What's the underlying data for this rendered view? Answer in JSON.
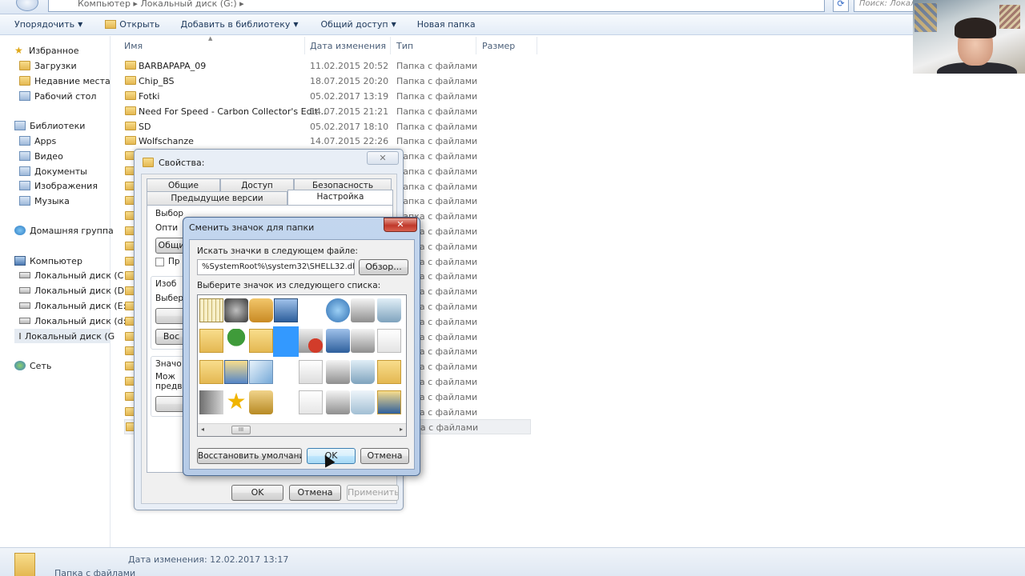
{
  "explorer": {
    "address_text": "Компьютер ▸ Локальный диск (G:) ▸",
    "search_placeholder": "Поиск: Локаль",
    "toolbar": {
      "organize": "Упорядочить",
      "open": "Открыть",
      "add_library": "Добавить в библиотеку",
      "share": "Общий доступ",
      "new_folder": "Новая папка"
    },
    "nav": {
      "favorites": "Избранное",
      "downloads": "Загрузки",
      "recent": "Недавние места",
      "desktop": "Рабочий стол",
      "libraries": "Библиотеки",
      "apps": "Apps",
      "video": "Видео",
      "documents": "Документы",
      "images": "Изображения",
      "music": "Музыка",
      "homegroup": "Домашняя группа",
      "computer": "Компьютер",
      "drive_c": "Локальный диск (C",
      "drive_d": "Локальный диск (D",
      "drive_e": "Локальный диск (E:",
      "drive_d2": "Локальный диск (d:",
      "drive_g": "Локальный диск (G",
      "network": "Сеть"
    },
    "columns": {
      "name": "Имя",
      "date": "Дата изменения",
      "type": "Тип",
      "size": "Размер"
    },
    "files": [
      {
        "name": "BARBAPAPA_09",
        "date": "11.02.2015 20:52",
        "type": "Папка с файлами"
      },
      {
        "name": "Chip_BS",
        "date": "18.07.2015 20:20",
        "type": "Папка с файлами"
      },
      {
        "name": "Fotki",
        "date": "05.02.2017 13:19",
        "type": "Папка с файлами"
      },
      {
        "name": "Need For Speed - Carbon Collector's Edit...",
        "date": "14.07.2015 21:21",
        "type": "Папка с файлами"
      },
      {
        "name": "SD",
        "date": "05.02.2017 18:10",
        "type": "Папка с файлами"
      },
      {
        "name": "Wolfschanze",
        "date": "14.07.2015 22:26",
        "type": "Папка с файлами"
      }
    ],
    "hidden_row_type": "Папка с файлами",
    "status": {
      "modified": "Дата изменения: 12.02.2017 13:17",
      "kind": "Папка с файлами"
    }
  },
  "properties_dialog": {
    "title": "Свойства:",
    "close": "✕",
    "tabs": {
      "general": "Общие",
      "access": "Доступ",
      "security": "Безопасность",
      "previous": "Предыдущие версии",
      "customize": "Настройка"
    },
    "partial": {
      "choose_type": "Выбор",
      "optimize": "Опти",
      "optimize_btn": "Общи",
      "apply_sub": "Пр",
      "images_group": "Изоб",
      "choose_file": "Выбер",
      "restore": "Вос",
      "icons_group": "Значо",
      "can_change": "Мож",
      "preview": "предв"
    },
    "ok": "OK",
    "cancel": "Отмена",
    "apply": "Применить"
  },
  "change_icon_dialog": {
    "title": "Сменить значок для папки",
    "close": "✕",
    "search_label": "Искать значки в следующем файле:",
    "path_value": "%SystemRoot%\\system32\\SHELL32.dll",
    "browse": "Обзор...",
    "list_label": "Выберите значок из следующего списка:",
    "scroll_thumb": "III",
    "restore_defaults": "Восстановить умолчания",
    "ok": "OK",
    "cancel": "Отмена"
  },
  "icon_names": [
    "keypad-icon",
    "monitor-settings-icon",
    "key-icon",
    "computer-settings-icon",
    "empty",
    "search-globe-icon",
    "printer-icon",
    "recycle-bin-full-icon",
    "folder-hdd-icon",
    "tree-icon",
    "folder-arrow-icon",
    "selected-blank-icon",
    "drive-error-icon",
    "network-icon",
    "printer-network-icon",
    "document-warning-icon",
    "font-a-icon",
    "computer-screen-icon",
    "picture-icon",
    "empty",
    "pages-icon",
    "printer-hand-icon",
    "recycle-bin-icon",
    "folder-warning-icon",
    "server-icon",
    "star-icon",
    "lock-icon",
    "empty",
    "search-document-icon",
    "printer-plus-icon",
    "recycle-bin-empty-icon",
    "folder-screen-icon"
  ]
}
